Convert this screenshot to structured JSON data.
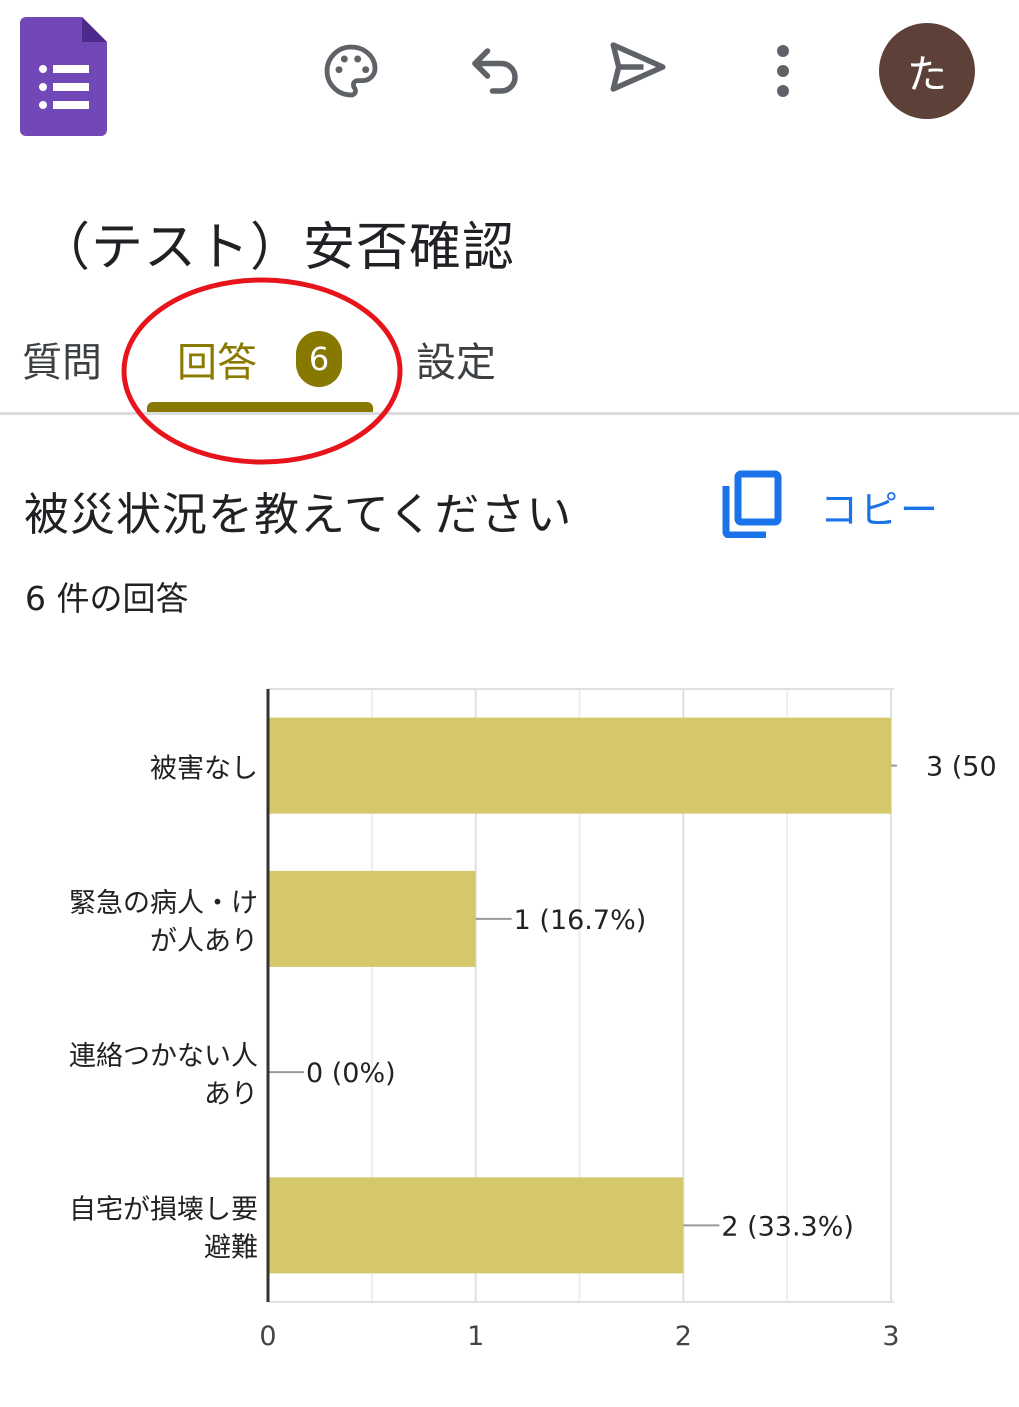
{
  "app": {
    "logo_icon": "google-forms-icon",
    "toolbar_icons": [
      "palette-icon",
      "undo-icon",
      "send-icon",
      "more-vert-icon"
    ],
    "avatar_initial": "た"
  },
  "form": {
    "title": "（テスト）安否確認"
  },
  "tabs": [
    {
      "label": "質問"
    },
    {
      "label": "回答",
      "badge": "6",
      "active": true
    },
    {
      "label": "設定"
    }
  ],
  "question": {
    "title": "被災状況を教えてください",
    "copy_label": "コピー",
    "response_count": "6 件の回答"
  },
  "colors": {
    "accent": "#877800",
    "bar": "#d4c86a",
    "annotation": "#e8141c",
    "link": "#1a73e8"
  },
  "chart_data": {
    "type": "bar",
    "orientation": "horizontal",
    "categories": [
      [
        "被害なし"
      ],
      [
        "緊急の病人・け",
        "が人あり"
      ],
      [
        "連絡つかない人",
        "あり"
      ],
      [
        "自宅が損壊し要",
        "避難"
      ]
    ],
    "values": [
      3,
      1,
      0,
      2
    ],
    "labels": [
      "3 (50",
      "1 (16.7%)",
      "0 (0%)",
      "2 (33.3%)"
    ],
    "xlim": [
      0,
      3
    ],
    "xticks": [
      "0",
      "1",
      "2",
      "3"
    ],
    "grid": true
  }
}
